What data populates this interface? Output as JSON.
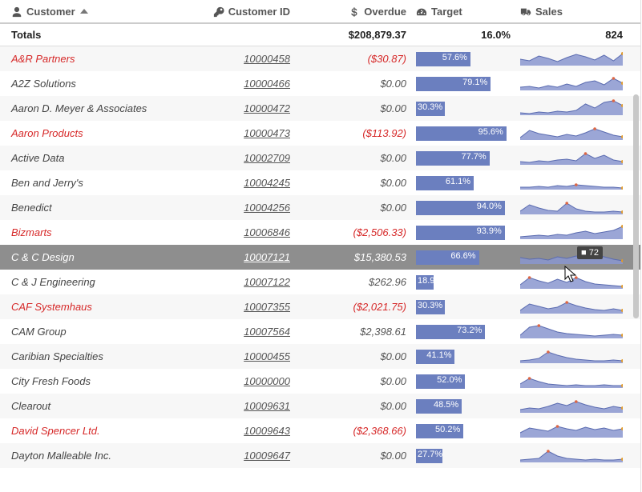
{
  "headers": {
    "customer": "Customer",
    "customer_id": "Customer ID",
    "overdue": "Overdue",
    "target": "Target",
    "sales": "Sales"
  },
  "totals": {
    "label": "Totals",
    "overdue": "$208,879.37",
    "target_pct": "16.0%",
    "sales": "824"
  },
  "tooltip": {
    "value": "72"
  },
  "chart_data": {
    "type": "table",
    "columns": [
      "Customer",
      "Customer ID",
      "Overdue",
      "Target %",
      "Sales Sparkline",
      "Overdue Negative",
      "Selected"
    ],
    "rows": [
      {
        "name": "A&R Partners",
        "id": "10000458",
        "overdue": "($30.87)",
        "neg": true,
        "target": 57.6,
        "spark": [
          8,
          6,
          12,
          9,
          5,
          10,
          14,
          11,
          7,
          13,
          6,
          15
        ],
        "selected": false
      },
      {
        "name": "A2Z Solutions",
        "id": "10000466",
        "overdue": "$0.00",
        "neg": false,
        "target": 79.1,
        "spark": [
          4,
          5,
          3,
          6,
          4,
          8,
          5,
          10,
          12,
          7,
          15,
          9
        ],
        "selected": false
      },
      {
        "name": "Aaron D. Meyer & Associates",
        "id": "10000472",
        "overdue": "$0.00",
        "neg": false,
        "target": 30.3,
        "spark": [
          3,
          2,
          4,
          3,
          5,
          4,
          6,
          14,
          9,
          16,
          18,
          12
        ],
        "selected": false
      },
      {
        "name": "Aaron Products",
        "id": "10000473",
        "overdue": "($113.92)",
        "neg": true,
        "target": 95.6,
        "spark": [
          3,
          12,
          8,
          6,
          4,
          7,
          5,
          9,
          14,
          10,
          6,
          4
        ],
        "selected": false
      },
      {
        "name": "Active Data",
        "id": "10002709",
        "overdue": "$0.00",
        "neg": false,
        "target": 77.7,
        "spark": [
          4,
          3,
          5,
          4,
          6,
          7,
          5,
          14,
          8,
          12,
          6,
          4
        ],
        "selected": false
      },
      {
        "name": "Ben and Jerry's",
        "id": "10004245",
        "overdue": "$0.00",
        "neg": false,
        "target": 61.1,
        "spark": [
          3,
          3,
          4,
          3,
          5,
          4,
          6,
          5,
          4,
          3,
          3,
          2
        ],
        "selected": false
      },
      {
        "name": "Benedict",
        "id": "10004256",
        "overdue": "$0.00",
        "neg": false,
        "target": 94.0,
        "spark": [
          4,
          12,
          8,
          5,
          4,
          14,
          7,
          4,
          3,
          3,
          4,
          3
        ],
        "selected": false
      },
      {
        "name": "Bizmarts",
        "id": "10006846",
        "overdue": "($2,506.33)",
        "neg": true,
        "target": 93.9,
        "spark": [
          3,
          4,
          5,
          4,
          6,
          5,
          8,
          10,
          7,
          9,
          11,
          16
        ],
        "selected": false
      },
      {
        "name": "C & C Design",
        "id": "10007121",
        "overdue": "$15,380.53",
        "neg": false,
        "target": 66.6,
        "spark": [
          8,
          6,
          7,
          5,
          9,
          7,
          10,
          8,
          12,
          9,
          6,
          4
        ],
        "selected": true
      },
      {
        "name": "C & J Engineering",
        "id": "10007122",
        "overdue": "$262.96",
        "neg": false,
        "target": 18.9,
        "spark": [
          5,
          14,
          10,
          7,
          12,
          8,
          14,
          9,
          6,
          5,
          4,
          3
        ],
        "selected": false
      },
      {
        "name": "CAF Systemhaus",
        "id": "10007355",
        "overdue": "($2,021.75)",
        "neg": true,
        "target": 30.3,
        "spark": [
          4,
          12,
          9,
          6,
          8,
          14,
          10,
          7,
          5,
          4,
          6,
          4
        ],
        "selected": false
      },
      {
        "name": "CAM Group",
        "id": "10007564",
        "overdue": "$2,398.61",
        "neg": false,
        "target": 73.2,
        "spark": [
          4,
          14,
          16,
          12,
          8,
          6,
          5,
          4,
          3,
          4,
          5,
          4
        ],
        "selected": false
      },
      {
        "name": "Caribian Specialties",
        "id": "10000455",
        "overdue": "$0.00",
        "neg": false,
        "target": 41.1,
        "spark": [
          3,
          4,
          6,
          14,
          10,
          7,
          5,
          4,
          3,
          3,
          4,
          3
        ],
        "selected": false
      },
      {
        "name": "City Fresh Foods",
        "id": "10000000",
        "overdue": "$0.00",
        "neg": false,
        "target": 52.0,
        "spark": [
          5,
          12,
          8,
          5,
          4,
          3,
          4,
          3,
          3,
          4,
          3,
          3
        ],
        "selected": false
      },
      {
        "name": "Clearout",
        "id": "10009631",
        "overdue": "$0.00",
        "neg": false,
        "target": 48.5,
        "spark": [
          4,
          6,
          5,
          8,
          12,
          9,
          14,
          10,
          7,
          5,
          8,
          6
        ],
        "selected": false
      },
      {
        "name": "David Spencer Ltd.",
        "id": "10009643",
        "overdue": "($2,368.66)",
        "neg": true,
        "target": 50.2,
        "spark": [
          6,
          12,
          10,
          8,
          14,
          11,
          9,
          13,
          10,
          12,
          9,
          11
        ],
        "selected": false
      },
      {
        "name": "Dayton Malleable Inc.",
        "id": "10009647",
        "overdue": "$0.00",
        "neg": false,
        "target": 27.7,
        "spark": [
          3,
          4,
          5,
          14,
          8,
          5,
          4,
          3,
          4,
          3,
          3,
          4
        ],
        "selected": false
      }
    ]
  }
}
